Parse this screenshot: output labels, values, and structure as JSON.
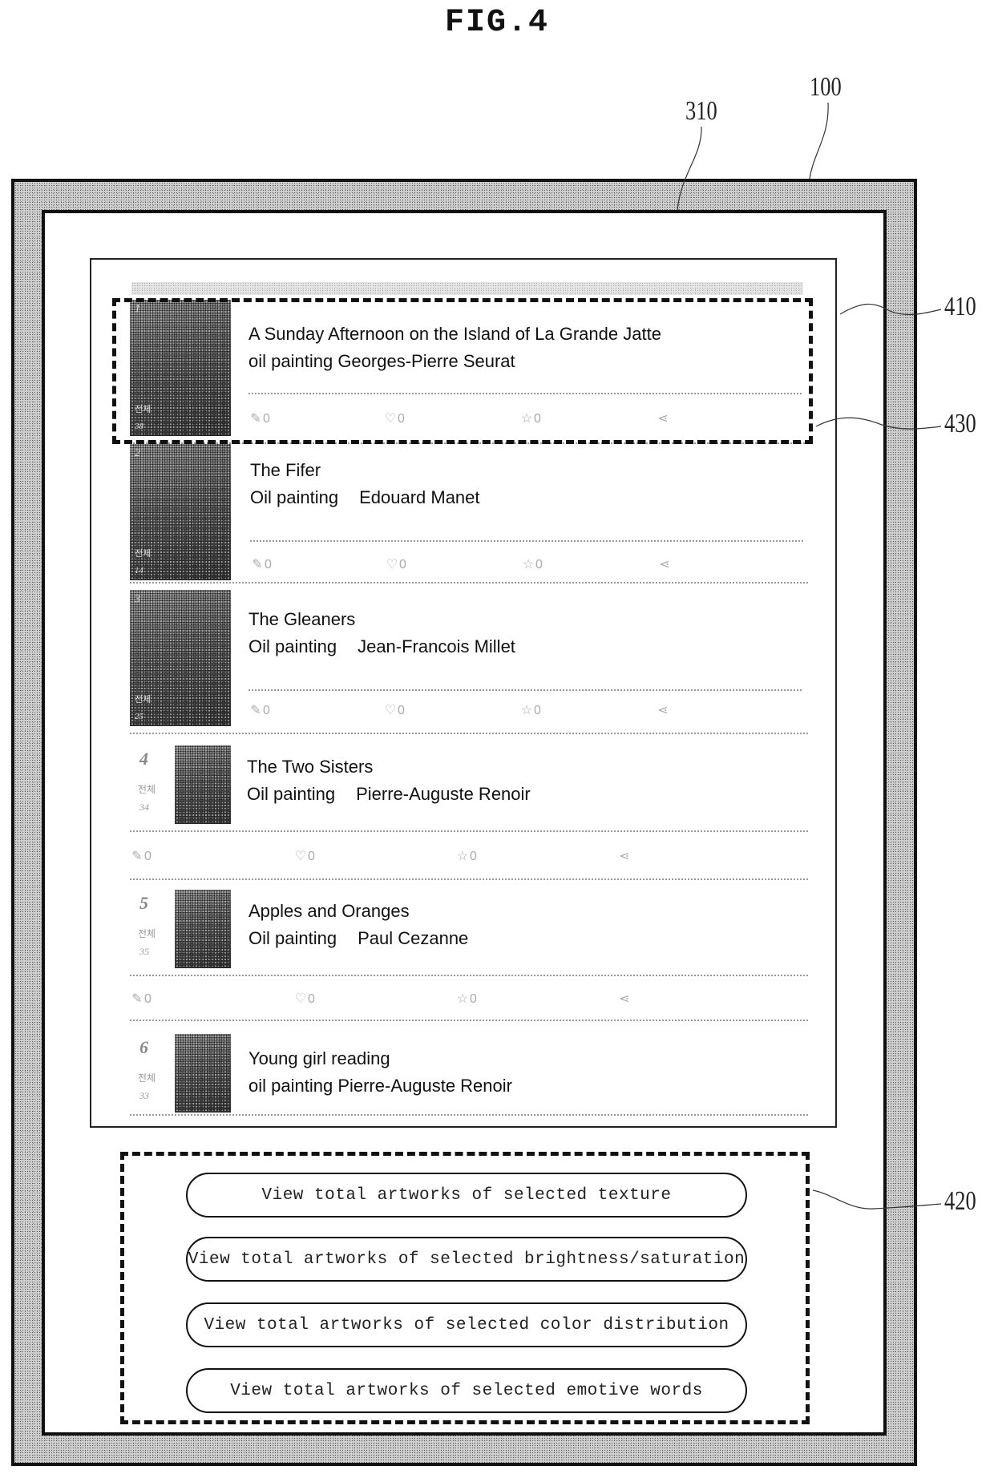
{
  "figure": {
    "title": "FIG.4"
  },
  "reference_labels": {
    "device": "100",
    "screen": "310",
    "selected_item": "410",
    "item_actions": "430",
    "button_group": "420"
  },
  "artworks": [
    {
      "rank": "1",
      "title": "A Sunday Afternoon on the Island of La Grande Jatte",
      "medium": "oil painting",
      "artist": "Georges-Pierre Seurat",
      "label": "전체",
      "count": "38",
      "actions": {
        "comment_count": "0",
        "like_count": "0",
        "favorite_count": "0"
      }
    },
    {
      "rank": "2",
      "title": "The Fifer",
      "medium": "Oil painting",
      "artist": "Edouard Manet",
      "label": "전체",
      "count": "14",
      "actions": {
        "comment_count": "0",
        "like_count": "0",
        "favorite_count": "0"
      }
    },
    {
      "rank": "3",
      "title": "The Gleaners",
      "medium": "Oil painting",
      "artist": "Jean-Francois Millet",
      "label": "전체",
      "count": "25",
      "actions": {
        "comment_count": "0",
        "like_count": "0",
        "favorite_count": "0"
      }
    },
    {
      "rank": "4",
      "title": "The Two Sisters",
      "medium": "Oil painting",
      "artist": "Pierre-Auguste Renoir",
      "label": "전체",
      "count": "34",
      "actions": {
        "comment_count": "0",
        "like_count": "0",
        "favorite_count": "0"
      }
    },
    {
      "rank": "5",
      "title": "Apples and Oranges",
      "medium": "Oil painting",
      "artist": "Paul Cezanne",
      "label": "전체",
      "count": "35",
      "actions": {
        "comment_count": "0",
        "like_count": "0",
        "favorite_count": "0"
      }
    },
    {
      "rank": "6",
      "title": "Young girl reading",
      "medium": "oil painting",
      "artist": "Pierre-Auguste Renoir",
      "label": "전체",
      "count": "33"
    }
  ],
  "icons": {
    "comment": "pencil-icon",
    "like": "heart-icon",
    "favorite": "star-icon",
    "share": "share-icon"
  },
  "buttons": [
    {
      "label": "View total artworks of selected texture"
    },
    {
      "label": "View total artworks of selected brightness/saturation"
    },
    {
      "label": "View total artworks of selected color distribution"
    },
    {
      "label": "View total artworks of selected emotive words"
    }
  ]
}
